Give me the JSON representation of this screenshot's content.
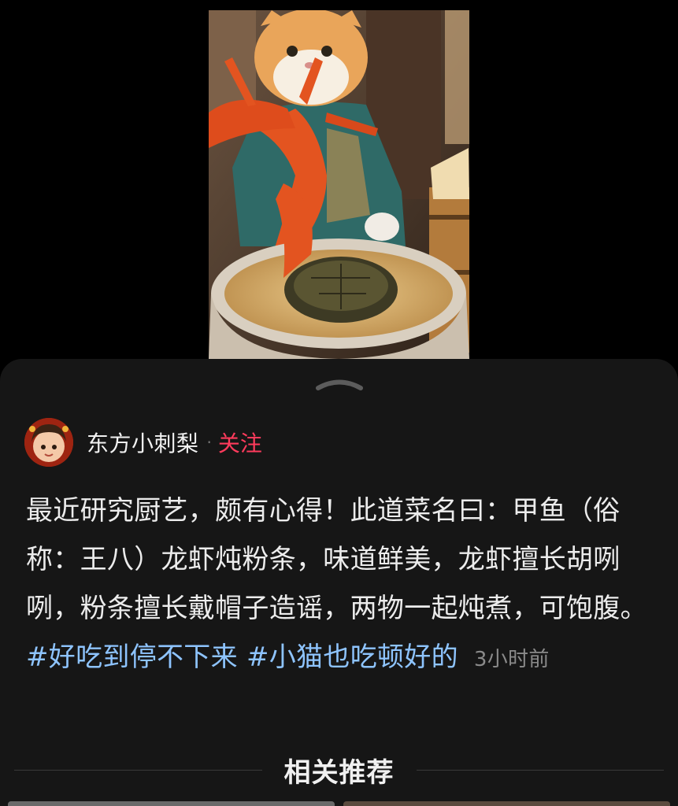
{
  "media": {
    "alt": "猫咪厨师举着龙虾，锅里炖着甲鱼"
  },
  "author": {
    "name": "东方小刺梨",
    "separator": "·",
    "follow_label": "关注"
  },
  "post": {
    "text": "最近研究厨艺，颇有心得！此道菜名曰：甲鱼（俗称：王八）龙虾炖粉条，味道鲜美，龙虾擅长胡咧咧，粉条擅长戴帽子造谣，两物一起炖煮，可饱腹。",
    "hashtags": [
      "#好吃到停不下来",
      "#小猫也吃顿好的"
    ],
    "time": "3小时前"
  },
  "related": {
    "title": "相关推荐"
  },
  "colors": {
    "accent_follow": "#ff3b5c",
    "hashtag": "#8ec4ff",
    "sheet_bg": "#161616"
  }
}
